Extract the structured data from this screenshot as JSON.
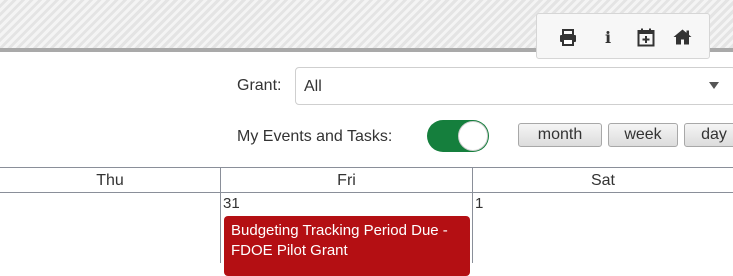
{
  "toolbar": {
    "icons": [
      "print-icon",
      "info-icon",
      "calendar-add-icon",
      "home-icon"
    ],
    "info_glyph": "i"
  },
  "filters": {
    "grant_label": "Grant:",
    "grant_value": "All",
    "my_events_label": "My Events and Tasks:",
    "my_events_on": true
  },
  "view_buttons": [
    {
      "label": "month"
    },
    {
      "label": "week"
    },
    {
      "label": "day"
    }
  ],
  "calendar": {
    "days": [
      "Thu",
      "Fri",
      "Sat"
    ],
    "dates": [
      "31",
      "1"
    ],
    "event": {
      "title": "Budgeting Tracking Period Due - FDOE Pilot Grant",
      "color": "#b40f13"
    }
  },
  "colors": {
    "toggle_on": "#157f3d",
    "event": "#b40f13"
  }
}
